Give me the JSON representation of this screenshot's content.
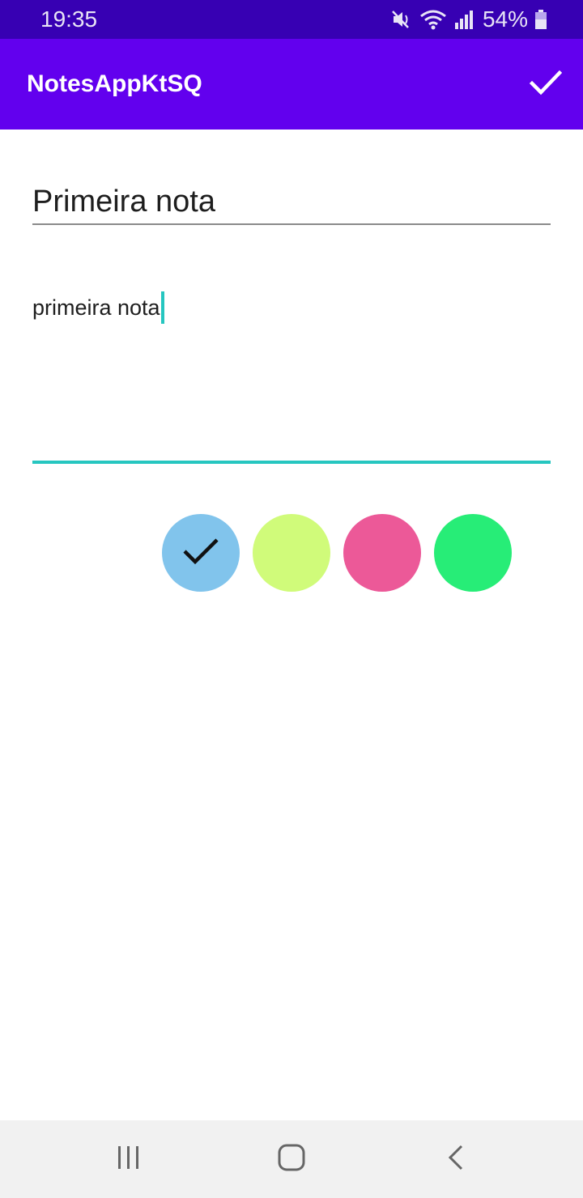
{
  "status_bar": {
    "time": "19:35",
    "battery_percent": "54%",
    "icons": [
      "mute-vibrate-icon",
      "wifi-icon",
      "signal-icon",
      "battery-icon"
    ]
  },
  "app_bar": {
    "title": "NotesAppKtSQ",
    "action_icon": "check-icon"
  },
  "note": {
    "title": "Primeira nota",
    "content": "primeira nota"
  },
  "color_picker": {
    "colors": [
      "#81c4ec",
      "#d0fb7a",
      "#ec5998",
      "#27ed77"
    ],
    "selected_index": 0
  },
  "nav_bar": {
    "icons": [
      "recents-icon",
      "home-icon",
      "back-icon"
    ]
  },
  "theme": {
    "status_bar": "#3700b3",
    "primary": "#6200ee",
    "accent": "#26c6c0"
  }
}
